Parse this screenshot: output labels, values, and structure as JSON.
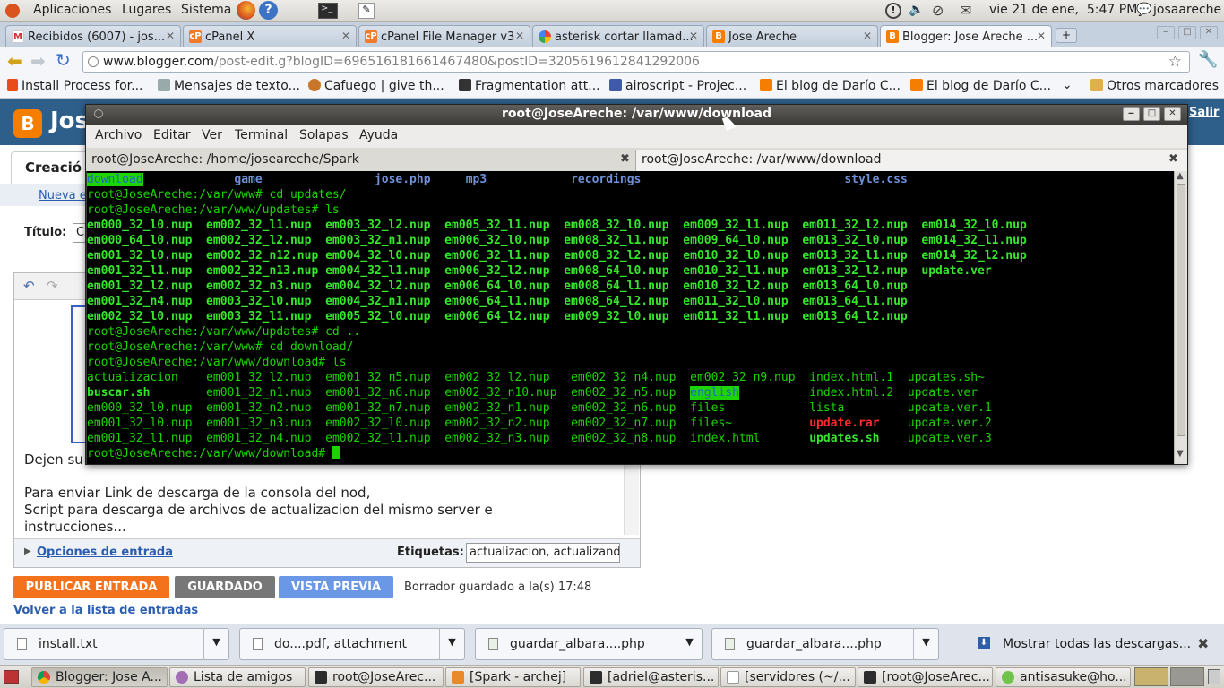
{
  "top_panel": {
    "menus": [
      "Aplicaciones",
      "Lugares",
      "Sistema"
    ],
    "datetime": "vie 21 de ene,  5:47 PM",
    "user": "josaareche"
  },
  "browser": {
    "tabs": [
      {
        "label": "Recibidos (6007) - jos...",
        "icon": "gmail-icon"
      },
      {
        "label": "cPanel X",
        "icon": "cpanel-icon"
      },
      {
        "label": "cPanel File Manager v3",
        "icon": "cpanel-icon"
      },
      {
        "label": "asterisk cortar llamad...",
        "icon": "google-icon"
      },
      {
        "label": "Jose Areche",
        "icon": "blogger-icon"
      },
      {
        "label": "Blogger: Jose Areche ...",
        "icon": "blogger-icon"
      }
    ],
    "url_host": "www.blogger.com",
    "url_path": "/post-edit.g?blogID=696516181661467480&postID=3205619612841292006",
    "bookmarks": [
      "Install Process for...",
      "Mensajes de texto...",
      "Cafuego | give th...",
      "Fragmentation att...",
      "airoscript - Projec...",
      "El blog de Darío C...",
      "El blog de Darío C..."
    ],
    "other_bookmarks": "Otros marcadores"
  },
  "blogger": {
    "logo_text": "Jos",
    "salir": "Salir",
    "tab_creation": "Creació",
    "new_entry_link": "Nueva e",
    "title_label": "Título:",
    "title_value": "C",
    "body_line1": "Dejen su",
    "body_line2": "Para enviar Link de descarga de la consola del nod,",
    "body_line3": "Script para descarga de archivos de actualizacion del mismo server e",
    "body_line4": "instrucciones...",
    "entry_options": "Opciones de entrada",
    "tags_label": "Etiquetas:",
    "tags_value": "actualizacion, actualizando",
    "publish_button": "PUBLICAR ENTRADA",
    "save_button": "GUARDADO",
    "preview_button": "VISTA PREVIA",
    "draft_status": "Borrador guardado a la(s) 17:48",
    "back_link": "Volver a la lista de entradas"
  },
  "terminal": {
    "title": "root@JoseAreche: /var/www/download",
    "menus": [
      "Archivo",
      "Editar",
      "Ver",
      "Terminal",
      "Solapas",
      "Ayuda"
    ],
    "tabs": [
      "root@JoseAreche: /home/joseareche/Spark",
      "root@JoseAreche: /var/www/download"
    ]
  },
  "downloads": {
    "items": [
      "install.txt",
      "do....pdf, attachment",
      "guardar_albara....php",
      "guardar_albara....php"
    ],
    "show_all": "Mostrar todas las descargas..."
  },
  "taskbar": {
    "items": [
      "Blogger: Jose A...",
      "Lista de amigos",
      "root@JoseArec...",
      "[Spark - archej]",
      "[adriel@asteris...",
      "[servidores (~/...",
      "[root@JoseArec...",
      "antisasuke@ho..."
    ]
  }
}
